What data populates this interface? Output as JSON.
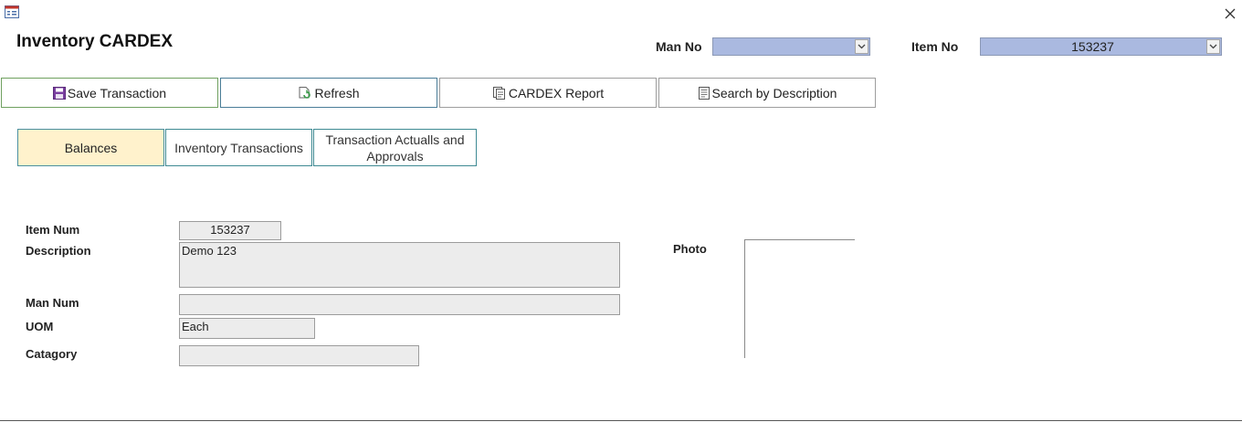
{
  "form": {
    "title": "Inventory CARDEX"
  },
  "header": {
    "man_no_label": "Man No",
    "man_no_value": "",
    "item_no_label": "Item No",
    "item_no_value": "153237"
  },
  "toolbar": {
    "save_label": "Save Transaction",
    "refresh_label": "Refresh",
    "report_label": "CARDEX Report",
    "search_label": "Search by Description"
  },
  "tabs": [
    {
      "label": "Balances",
      "active": true
    },
    {
      "label": "Inventory Transactions",
      "active": false
    },
    {
      "label": "Transaction Actualls and Approvals",
      "active": false
    }
  ],
  "fields": {
    "item_num": {
      "label": "Item Num",
      "value": "153237"
    },
    "description": {
      "label": "Description",
      "value": "Demo 123"
    },
    "man_num": {
      "label": "Man Num",
      "value": ""
    },
    "uom": {
      "label": "UOM",
      "value": "Each"
    },
    "catagory": {
      "label": "Catagory",
      "value": ""
    },
    "photo": {
      "label": "Photo"
    }
  },
  "colors": {
    "combo_bg": "#aab9e0",
    "active_tab_bg": "#fff2cc",
    "field_bg": "#ececec",
    "save_icon": "#7a3fa0",
    "refresh_icon": "#3a9a4a"
  },
  "icons": {
    "form": "form-icon",
    "close": "close-icon",
    "save": "save-icon",
    "refresh": "refresh-icon",
    "report": "report-icon",
    "search": "search-icon",
    "dropdown": "chevron-down-icon"
  }
}
